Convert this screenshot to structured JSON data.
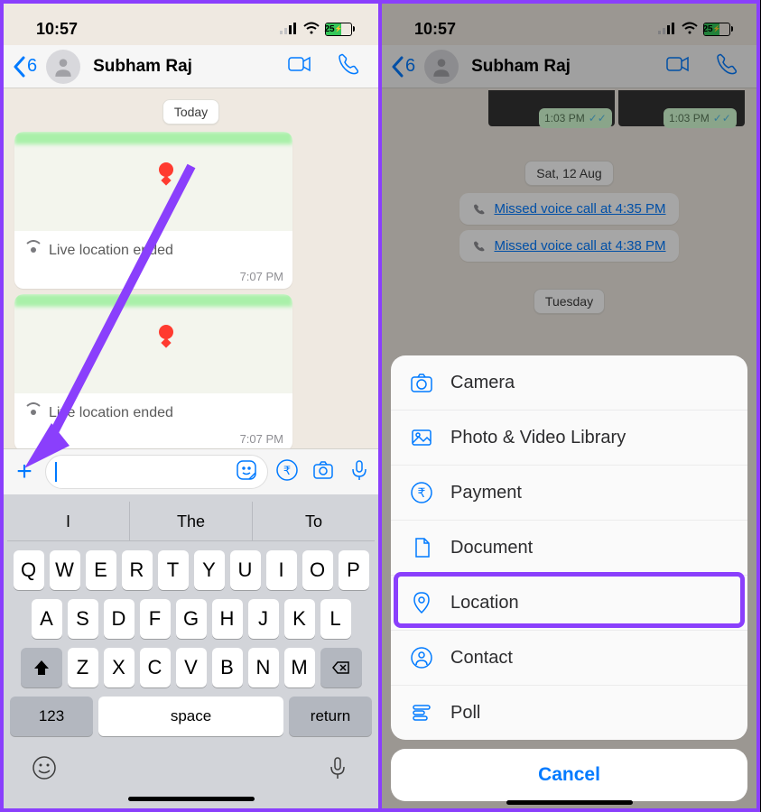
{
  "status": {
    "time": "10:57",
    "battery_pct": "25"
  },
  "header": {
    "back_count": "6",
    "contact_name": "Subham Raj"
  },
  "chat_left": {
    "date_label": "Today",
    "loc1_text": "Live location ended",
    "loc1_time": "7:07 PM",
    "loc2_text": "Live location ended",
    "loc2_time": "7:07 PM"
  },
  "keyboard": {
    "pred1": "I",
    "pred2": "The",
    "pred3": "To",
    "row1": [
      "Q",
      "W",
      "E",
      "R",
      "T",
      "Y",
      "U",
      "I",
      "O",
      "P"
    ],
    "row2": [
      "A",
      "S",
      "D",
      "F",
      "G",
      "H",
      "J",
      "K",
      "L"
    ],
    "row3": [
      "Z",
      "X",
      "C",
      "V",
      "B",
      "N",
      "M"
    ],
    "num_label": "123",
    "space_label": "space",
    "return_label": "return"
  },
  "chat_right": {
    "badge1_time": "1:03 PM",
    "badge2_time": "1:03 PM",
    "date_label": "Sat, 12 Aug",
    "missed1": "Missed voice call at 4:35 PM",
    "missed2": "Missed voice call at 4:38 PM",
    "date_label2": "Tuesday"
  },
  "sheet": {
    "camera": "Camera",
    "library": "Photo & Video Library",
    "payment": "Payment",
    "document": "Document",
    "location": "Location",
    "contact": "Contact",
    "poll": "Poll",
    "cancel": "Cancel"
  }
}
